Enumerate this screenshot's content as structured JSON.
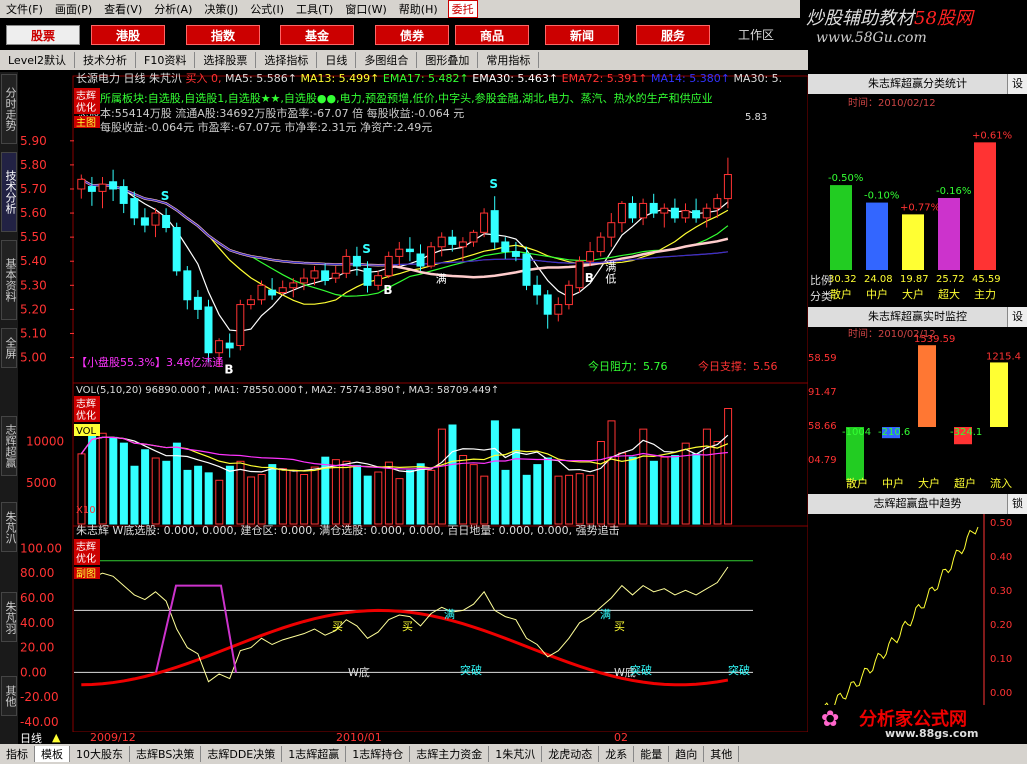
{
  "menu": [
    "文件(F)",
    "画面(P)",
    "查看(V)",
    "分析(A)",
    "决策(J)",
    "公式(I)",
    "工具(T)",
    "窗口(W)",
    "帮助(H)"
  ],
  "menu_trade": "委托",
  "brand": {
    "line1": "炒股辅助教材",
    "line1b": "58股网",
    "line2": "www.58Gu.com"
  },
  "buttons": [
    "股票",
    "港股",
    "指数",
    "基金",
    "债券",
    "商品",
    "新闻",
    "服务"
  ],
  "workzone": "工作区",
  "toolbar": [
    "Level2默认",
    "技术分析",
    "F10资料",
    "选择股票",
    "选择指标",
    "日线",
    "多图组合",
    "图形叠加",
    "常用指标"
  ],
  "side_tabs": [
    "分时走势",
    "技术分析",
    "基本资料",
    "全屏",
    "志辉超赢",
    "朱芃汃",
    "朱芃羽",
    "其他"
  ],
  "kline": {
    "header_prefix": "长源电力 日线 朱芃汃",
    "header_buy": "买入 0,",
    "ma5": "MA5: 5.586↑",
    "ma13": "MA13: 5.499↑",
    "ema17": "EMA17: 5.482↑",
    "ema30": "EMA30: 5.463↑",
    "ema72": "EMA72: 5.391↑",
    "ma14": "MA14: 5.380↑",
    "ma30": "MA30: 5.",
    "info1": "所属板块:自选股,自选股1,自选股★★,自选股●●,电力,预盈预增,低价,中字头,参股金融,湖北,电力、蒸汽、热水的生产和供应业",
    "info2": "总股本:55414万股  流通A股:34692万股市盈率:-67.07 倍  每股收益:-0.064 元",
    "info3": "每股收益:-0.064元 市盈率:-67.07元 市净率:2.31元 净资产:2.49元",
    "small": "【小盘股55.3%】3.46亿流通",
    "zuli": "今日阻力：5.76",
    "zhicheng": "今日支撑：5.56",
    "label_zhihui": "志辉",
    "label_youhua": "优化",
    "label_zhutu": "主图",
    "last_price": "5.83",
    "markers": {
      "S": "S",
      "B": "B",
      "man": "满",
      "di": "低"
    }
  },
  "vol": {
    "header": "VOL(5,10,20) 96890.000↑, MA1: 78550.000↑, MA2: 75743.890↑, MA3: 58709.449↑",
    "tag": "VOL",
    "x10": "X10"
  },
  "sub": {
    "header": "朱志辉 W底选股: 0.000, 0.000, 建仓区: 0.000,     满仓选股: 0.000,      0.000, 百日地量: 0.000, 0.000, 强势追击",
    "label_futu": "副图",
    "wdi": "W底",
    "tupo": "突破",
    "mai": "买",
    "man": "满"
  },
  "timeaxis": {
    "period": "日线",
    "labels": [
      "2009/12",
      "2010/01",
      "02"
    ]
  },
  "right_panel": {
    "p1": {
      "title": "朱志辉超赢分类统计",
      "set": "设",
      "time": "时间：2010/02/12",
      "bars": [
        {
          "label": "散户",
          "pct": "-0.50%",
          "val": "30.32",
          "pct_num": -0.5,
          "value": 30.32,
          "color": "#22cc22"
        },
        {
          "label": "中户",
          "pct": "-0.10%",
          "val": "24.08",
          "pct_num": -0.1,
          "value": 24.08,
          "color": "#3366ff"
        },
        {
          "label": "大户",
          "pct": "+0.77%",
          "val": "19.87",
          "pct_num": 0.77,
          "value": 19.87,
          "color": "#ffff33"
        },
        {
          "label": "超大",
          "pct": "-0.16%",
          "val": "25.72",
          "pct_num": -0.16,
          "value": 25.72,
          "color": "#cc33cc"
        },
        {
          "label": "主力",
          "pct": "+0.61%",
          "val": "45.59",
          "pct_num": 0.61,
          "value": 45.59,
          "color": "#ff3333"
        }
      ],
      "side": [
        "比例",
        "分类"
      ]
    },
    "p2": {
      "title": "朱志辉超赢实时监控",
      "set": "设",
      "time": "时间：2010/02/12",
      "axis": [
        "58.59",
        "91.47",
        "58.66",
        "04.79"
      ],
      "bars": [
        {
          "label": "散户",
          "val": "-1004",
          "value": -1004,
          "color": "#22cc22"
        },
        {
          "label": "中户",
          "val": "-210.6",
          "value": -210.6,
          "color": "#3366ff"
        },
        {
          "label": "大户",
          "val": "1539.59",
          "value": 1539.59,
          "color": "#ff7733"
        },
        {
          "label": "超户",
          "val": "-324.1",
          "value": -324.1,
          "color": "#ff3333"
        },
        {
          "label": "流入",
          "val": "1215.4",
          "value": 1215.4,
          "color": "#ffff33"
        }
      ]
    },
    "p3": {
      "title": "志辉超赢盘中趋势",
      "lock": "锁",
      "axis": [
        "0.50",
        "0.40",
        "0.30",
        "0.20",
        "0.10",
        "0.00",
        "-0.10"
      ]
    }
  },
  "bottom": [
    "指标",
    "模板",
    "10大股东",
    "志辉BS决策",
    "志辉DDE决策",
    "1志辉超赢",
    "1志辉持仓",
    "志辉主力资金",
    "1朱芃汃",
    "龙虎动态",
    "龙系",
    "能量",
    "趋向",
    "其他"
  ],
  "logo2": "分析家公式网",
  "logo2_url": "www.88gs.com",
  "chart_data": {
    "type": "candlestick",
    "y_axis": [
      5.9,
      5.8,
      5.7,
      5.6,
      5.5,
      5.4,
      5.3,
      5.2,
      5.1,
      5.0
    ],
    "ylim": [
      4.94,
      5.92
    ],
    "candles": [
      [
        5.7,
        5.76,
        5.66,
        5.74
      ],
      [
        5.71,
        5.75,
        5.63,
        5.69
      ],
      [
        5.69,
        5.75,
        5.62,
        5.72
      ],
      [
        5.73,
        5.78,
        5.65,
        5.7
      ],
      [
        5.71,
        5.74,
        5.6,
        5.64
      ],
      [
        5.66,
        5.69,
        5.55,
        5.58
      ],
      [
        5.58,
        5.62,
        5.52,
        5.55
      ],
      [
        5.55,
        5.62,
        5.5,
        5.6
      ],
      [
        5.59,
        5.62,
        5.52,
        5.54
      ],
      [
        5.54,
        5.56,
        5.34,
        5.36
      ],
      [
        5.36,
        5.38,
        5.2,
        5.24
      ],
      [
        5.25,
        5.28,
        5.16,
        5.2
      ],
      [
        5.21,
        5.24,
        4.98,
        5.02
      ],
      [
        5.02,
        5.08,
        4.96,
        5.07
      ],
      [
        5.06,
        5.1,
        5.0,
        5.04
      ],
      [
        5.05,
        5.24,
        5.03,
        5.22
      ],
      [
        5.22,
        5.26,
        5.2,
        5.24
      ],
      [
        5.24,
        5.32,
        5.22,
        5.3
      ],
      [
        5.28,
        5.33,
        5.24,
        5.26
      ],
      [
        5.27,
        5.32,
        5.26,
        5.29
      ],
      [
        5.29,
        5.33,
        5.25,
        5.31
      ],
      [
        5.31,
        5.37,
        5.28,
        5.33
      ],
      [
        5.33,
        5.38,
        5.3,
        5.36
      ],
      [
        5.36,
        5.39,
        5.3,
        5.32
      ],
      [
        5.33,
        5.38,
        5.31,
        5.35
      ],
      [
        5.35,
        5.45,
        5.33,
        5.42
      ],
      [
        5.42,
        5.46,
        5.34,
        5.38
      ],
      [
        5.37,
        5.4,
        5.27,
        5.3
      ],
      [
        5.3,
        5.36,
        5.28,
        5.34
      ],
      [
        5.34,
        5.44,
        5.33,
        5.42
      ],
      [
        5.42,
        5.48,
        5.38,
        5.45
      ],
      [
        5.45,
        5.5,
        5.4,
        5.44
      ],
      [
        5.43,
        5.47,
        5.36,
        5.38
      ],
      [
        5.38,
        5.48,
        5.37,
        5.46
      ],
      [
        5.46,
        5.52,
        5.42,
        5.5
      ],
      [
        5.5,
        5.53,
        5.44,
        5.47
      ],
      [
        5.46,
        5.5,
        5.4,
        5.48
      ],
      [
        5.48,
        5.53,
        5.46,
        5.52
      ],
      [
        5.52,
        5.62,
        5.5,
        5.6
      ],
      [
        5.61,
        5.67,
        5.45,
        5.48
      ],
      [
        5.48,
        5.5,
        5.41,
        5.44
      ],
      [
        5.44,
        5.48,
        5.4,
        5.42
      ],
      [
        5.43,
        5.46,
        5.28,
        5.3
      ],
      [
        5.3,
        5.34,
        5.22,
        5.26
      ],
      [
        5.26,
        5.28,
        5.12,
        5.18
      ],
      [
        5.18,
        5.25,
        5.15,
        5.22
      ],
      [
        5.22,
        5.32,
        5.2,
        5.3
      ],
      [
        5.29,
        5.42,
        5.27,
        5.4
      ],
      [
        5.4,
        5.48,
        5.38,
        5.44
      ],
      [
        5.44,
        5.52,
        5.42,
        5.5
      ],
      [
        5.5,
        5.6,
        5.46,
        5.56
      ],
      [
        5.56,
        5.65,
        5.52,
        5.64
      ],
      [
        5.64,
        5.67,
        5.56,
        5.58
      ],
      [
        5.58,
        5.66,
        5.55,
        5.64
      ],
      [
        5.64,
        5.68,
        5.58,
        5.6
      ],
      [
        5.6,
        5.64,
        5.54,
        5.62
      ],
      [
        5.62,
        5.66,
        5.56,
        5.58
      ],
      [
        5.58,
        5.64,
        5.56,
        5.61
      ],
      [
        5.61,
        5.66,
        5.56,
        5.58
      ],
      [
        5.58,
        5.64,
        5.54,
        5.62
      ],
      [
        5.62,
        5.68,
        5.58,
        5.66
      ],
      [
        5.66,
        5.83,
        5.62,
        5.76
      ]
    ],
    "volume": [
      8500,
      12000,
      11000,
      10500,
      9800,
      7000,
      9000,
      8000,
      7600,
      9800,
      6500,
      7000,
      6200,
      5300,
      7000,
      7600,
      5700,
      6000,
      7200,
      6700,
      6500,
      6000,
      6900,
      8100,
      7800,
      7600,
      7100,
      5800,
      6300,
      7500,
      5500,
      6500,
      7300,
      6500,
      11500,
      12000,
      8300,
      7200,
      5800,
      12500,
      6500,
      11500,
      5900,
      7200,
      8000,
      5800,
      5900,
      6100,
      5900,
      10000,
      12500,
      8600,
      8100,
      11500,
      7600,
      8100,
      8300,
      9800,
      8500,
      11500,
      10000,
      14000
    ],
    "sub_ylim": [
      -40,
      110
    ],
    "sub_axis": [
      100.0,
      80.0,
      60.0,
      40.0,
      20.0,
      0.0,
      -20.0,
      -40.0
    ]
  }
}
